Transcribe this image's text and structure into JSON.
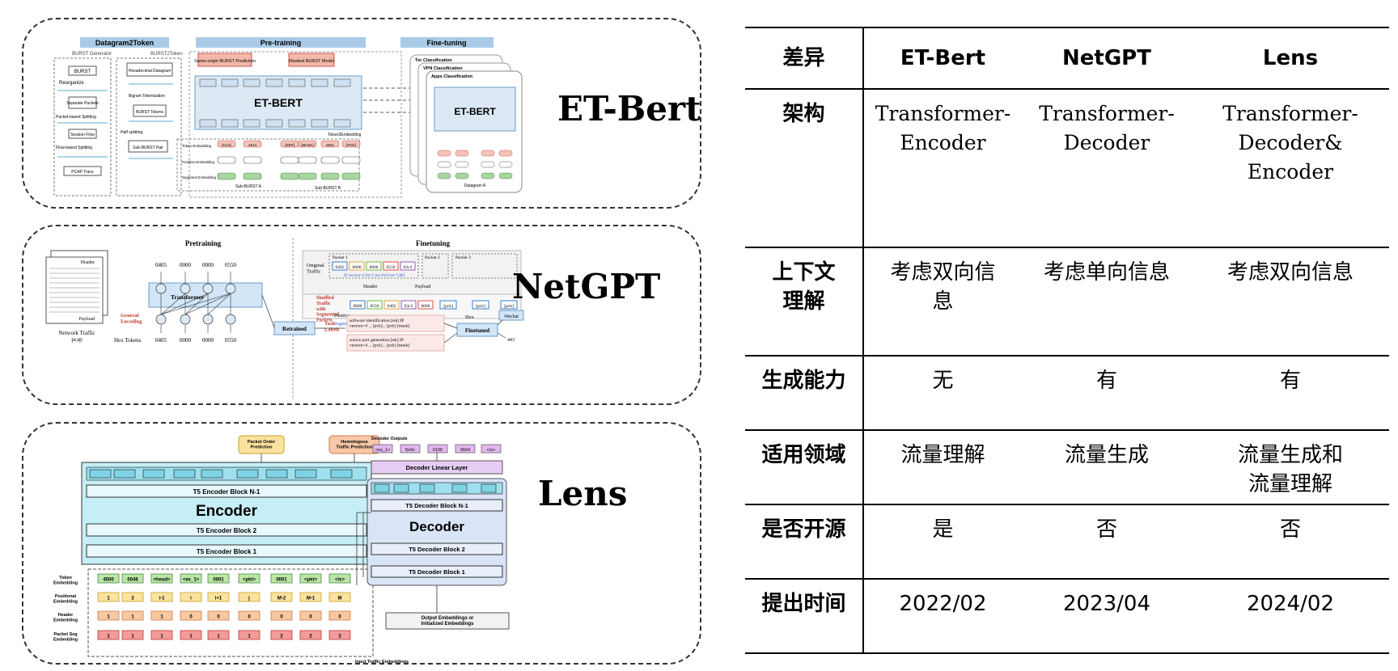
{
  "panels": {
    "etbert": {
      "title": "ET-Bert",
      "headers": [
        "Datagram2Token",
        "Pre-training",
        "Fine-tuning"
      ],
      "left_labels": [
        "BURST Generator",
        "BURST2Token",
        "Reorganize",
        "BURST",
        "Hexadecimal Datagram",
        "Separate Packets",
        "Bigram Tokenization",
        "Packet-based Splitting",
        "BURST Tokens",
        "Session Flow",
        "Half splitting",
        "Flow-based Splitting",
        "Sub-BURST Pair",
        "PCAP Trace"
      ],
      "pretrain_boxes": [
        "Same-origin BURST Prediction",
        "Masked BURST Model"
      ],
      "model_name": "ET-BERT",
      "embedding_labels": [
        "Token Embedding",
        "Position Embedding",
        "Segment Embedding"
      ],
      "tokens": [
        "[CLS]",
        "4514",
        "[SEP]",
        "[MASK]",
        "583c",
        "[PAD]"
      ],
      "sub_burst": [
        "Sub-BURST A",
        "Sub-BURST B"
      ],
      "token_embedding_label": "Token2Embedding",
      "finetune_tasks": [
        "Tor Classification",
        "VPN Classification",
        "Apps Classification"
      ],
      "finetune_model": "ET-BERT",
      "finetune_caption": "Datagram A"
    },
    "netgpt": {
      "title": "NetGPT",
      "pretraining_header": "Pretraining",
      "finetuning_header": "Finetuning",
      "doc_labels": [
        "Header",
        "Payload"
      ],
      "network_caption": "Network Traffic\npcap",
      "general_encoding": "General\nEncoding",
      "hex_tokens_label": "Hex Tokens",
      "hex_top": [
        "0405",
        "0000",
        "0000",
        "0550"
      ],
      "hex_bottom": [
        "0405",
        "0000",
        "0000",
        "0550"
      ],
      "transformer_label": "Transformer",
      "original_traffic": "Original\nTraffic",
      "packets": [
        "Packet 1",
        "Packet 2",
        "Packet 3"
      ],
      "packet_hex": [
        "0405",
        "0000",
        "0000",
        "0550",
        "03c2"
      ],
      "ip_line": "IP version=4 ihl=5 tos=0x8 len=5380",
      "header_label": "Header",
      "payload_label": "Payload",
      "shuffled_label": "Shuffled\nTraffic\nwith\nSegmented\nPackets",
      "shuffled_hex": [
        "0000",
        "0550",
        "0405",
        "03c2",
        "0000",
        "[pck]",
        "[pck]",
        "[pck]"
      ],
      "position_label": "Position",
      "segment_label": "Segment",
      "retrained_label": "Retrained",
      "task_labels": "Task\nLabels",
      "task1": "software identification [tsk] IP\nversion=4 ... [pck]... [pck] [mask]",
      "task2": "source port generation [tsk] IP\nversion=4 ... [pck]... [pck] [mask]",
      "finetuned_label": "Finetuned",
      "hex_out": "Hex",
      "wechat": "Wechat",
      "port": "443"
    },
    "lens": {
      "title": "Lens",
      "packet_order": "Packet Order\nPrediction",
      "homologous": "Homologous\nTraffic Prediction",
      "decoder_outputs_label": "Decoder Outputs",
      "decoder_outputs": [
        "<ex_1>",
        "5e9c",
        "0100",
        "0664",
        "</s>"
      ],
      "encoder_block_top": "T5 Encoder Block N-1",
      "encoder_label": "Encoder",
      "encoder_block2": "T5 Encoder Block 2",
      "encoder_block1": "T5 Encoder Block 1",
      "decoder_linear": "Decoder Linear Layer",
      "decoder_block_top": "T5 Decoder Block N-1",
      "decoder_label": "Decoder",
      "decoder_block2": "T5 Decoder Block 2",
      "decoder_block1": "T5 Decoder Block 1",
      "output_embeddings": "Output Embeddings or\nInitialized Embeddings",
      "embedding_rows": [
        "Token\nEmbedding",
        "Positional\nEmbedding",
        "Header\nEmbedding",
        "Packet Seg\nEmbedding"
      ],
      "tokens": [
        "4500",
        "0046",
        "<head>",
        "<ex_1>",
        "0001",
        "<pkt>",
        "0001",
        "<pkt>",
        "</s>"
      ],
      "positions": [
        "1",
        "2",
        "i-1",
        "i",
        "i+1",
        "j",
        "M-2",
        "M-1",
        "M"
      ],
      "headers": [
        "1",
        "1",
        "1",
        "0",
        "0",
        "0",
        "0",
        "0",
        "0"
      ],
      "segments": [
        "1",
        "1",
        "1",
        "1",
        "1",
        "1",
        "2",
        "2",
        "2"
      ],
      "input_caption": "Input Traffic Embeddings"
    }
  },
  "table": {
    "columns": [
      "差异",
      "ET-Bert",
      "NetGPT",
      "Lens"
    ],
    "rows": [
      {
        "label": "架构",
        "values": [
          "Transformer-\nEncoder",
          "Transformer-\nDecoder",
          "Transformer-\nDecoder&\nEncoder"
        ]
      },
      {
        "label": "上下文\n理解",
        "values": [
          "考虑双向信\n息",
          "考虑单向信息",
          "考虑双向信息"
        ]
      },
      {
        "label": "生成能力",
        "values": [
          "无",
          "有",
          "有"
        ]
      },
      {
        "label": "适用领域",
        "values": [
          "流量理解",
          "流量生成",
          "流量生成和\n流量理解"
        ]
      },
      {
        "label": "是否开源",
        "values": [
          "是",
          "否",
          "否"
        ]
      },
      {
        "label": "提出时间",
        "values": [
          "2022/02",
          "2023/04",
          "2024/02"
        ]
      }
    ]
  }
}
